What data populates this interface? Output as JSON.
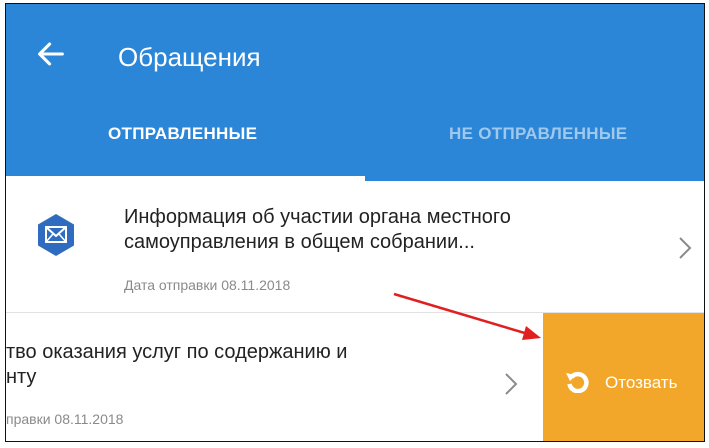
{
  "header": {
    "title": "Обращения",
    "tabs": [
      {
        "label": "ОТПРАВЛЕННЫЕ",
        "active": true
      },
      {
        "label": "НЕ ОТПРАВЛЕННЫЕ",
        "active": false
      }
    ]
  },
  "messages": [
    {
      "title_line1": "Информация об участии органа местного",
      "title_line2": "самоуправления в общем собрании...",
      "date": "Дата отправки 08.11.2018"
    },
    {
      "title_line1": "тво оказания услуг по содержанию и",
      "title_line2": "нту",
      "date": "правки 08.11.2018",
      "swipe_action": "Отозвать"
    }
  ],
  "colors": {
    "appbar": "#2b86d8",
    "recall": "#f3a72a",
    "annotation_arrow": "#e02020"
  }
}
